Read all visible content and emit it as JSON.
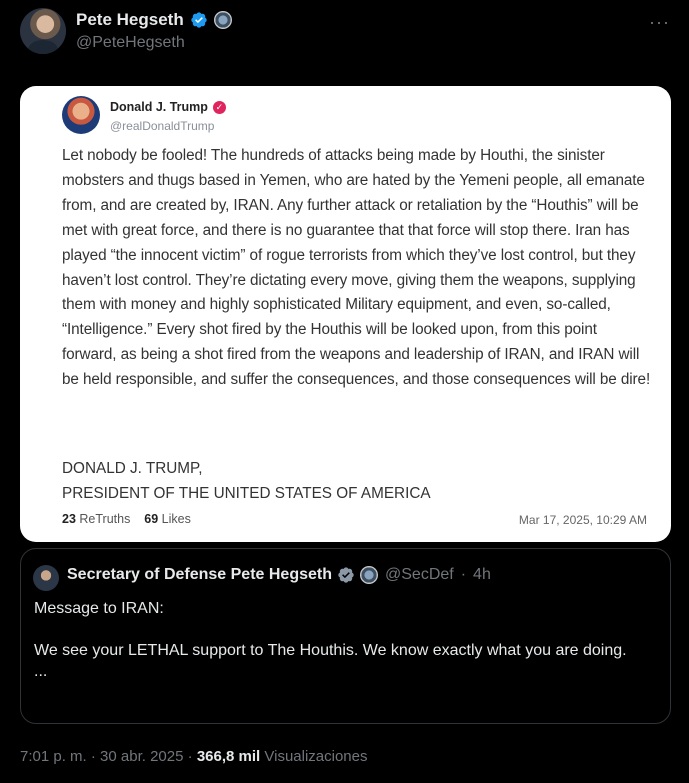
{
  "author": {
    "name": "Pete Hegseth",
    "handle": "@PeteHegseth",
    "verified_icon": "verified-badge-icon",
    "affiliation_icon": "dod-seal-icon",
    "more_icon": "more-options-icon",
    "more_glyph": "···"
  },
  "truth_post": {
    "name": "Donald J. Trump",
    "handle": "@realDonaldTrump",
    "verified_glyph": "✓",
    "body": "Let nobody be fooled! The hundreds of attacks being made by Houthi, the sinister mobsters and thugs based in Yemen, who are hated by the Yemeni people, all emanate from, and are created by, IRAN. Any further attack or retaliation by the “Houthis” will be met with great force, and there is no guarantee that that force will stop there. Iran has played “the innocent victim” of rogue terrorists from which they’ve lost control, but they haven’t lost control. They’re dictating every move, giving them the weapons, supplying them with money and highly sophisticated Military equipment, and even, so-called, “Intelligence.” Every shot fired by the Houthis will be looked upon, from this point forward, as being a shot fired from the weapons and leadership of IRAN, and IRAN will be held responsible, and suffer the consequences, and those consequences will be dire!",
    "signature_line1": "DONALD J. TRUMP,",
    "signature_line2": "PRESIDENT OF THE UNITED STATES OF AMERICA",
    "retruths_count": "23",
    "retruths_label": "ReTruths",
    "likes_count": "69",
    "likes_label": "Likes",
    "date": "Mar 17, 2025, 10:29 AM"
  },
  "quoted_tweet": {
    "name": "Secretary of Defense Pete Hegseth",
    "handle": "@SecDef",
    "separator": "·",
    "time": "4h",
    "line1": "Message to IRAN:",
    "line2": "We see your LETHAL support to The Houthis. We know exactly what you are doing.",
    "line3": "..."
  },
  "footer": {
    "time": "7:01 p. m.",
    "separator": "·",
    "date": "30 abr. 2025",
    "views_count": "366,8 mil",
    "views_label": "Visualizaciones"
  },
  "colors": {
    "background": "#000000",
    "text_primary": "#e7e9ea",
    "text_secondary": "#71767b",
    "verified_blue": "#1d9bf0",
    "truth_verified": "#e0245e"
  }
}
